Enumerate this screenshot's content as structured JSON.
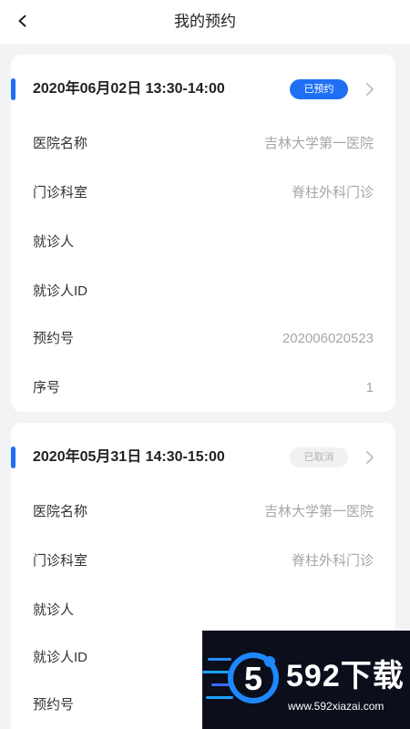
{
  "header": {
    "title": "我的预约"
  },
  "appointments": [
    {
      "datetime": "2020年06月02日 13:30-14:00",
      "status": "已预约",
      "fields": [
        {
          "label": "医院名称",
          "value": "吉林大学第一医院"
        },
        {
          "label": "门诊科室",
          "value": "脊柱外科门诊"
        },
        {
          "label": "就诊人",
          "value": ""
        },
        {
          "label": "就诊人ID",
          "value": ""
        },
        {
          "label": "预约号",
          "value": "202006020523"
        },
        {
          "label": "序号",
          "value": "1"
        }
      ]
    },
    {
      "datetime": "2020年05月31日 14:30-15:00",
      "status": "已取消",
      "fields": [
        {
          "label": "医院名称",
          "value": "吉林大学第一医院"
        },
        {
          "label": "门诊科室",
          "value": "脊柱外科门诊"
        },
        {
          "label": "就诊人",
          "value": ""
        },
        {
          "label": "就诊人ID",
          "value": ""
        },
        {
          "label": "预约号",
          "value": ""
        }
      ]
    }
  ],
  "watermark": {
    "brand": "592下载",
    "url": "www.592xiazai.com",
    "logo_digit": "5"
  },
  "colors": {
    "accent": "#1f6ff5",
    "page_bg": "#f2f3f5"
  },
  "icons": {
    "back": "chevron-left-icon",
    "detail": "chevron-right-icon"
  }
}
